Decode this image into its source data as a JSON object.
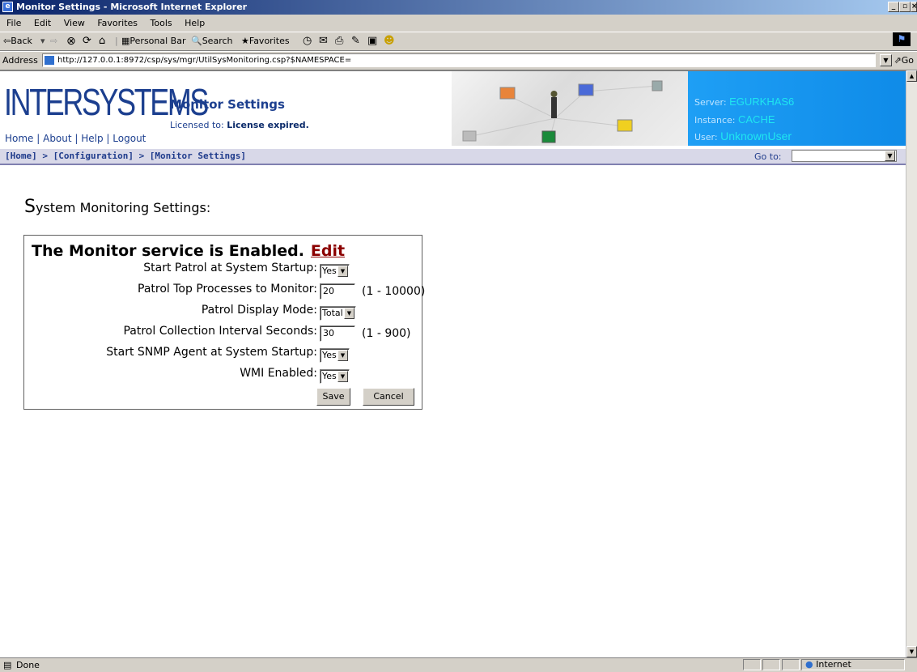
{
  "window": {
    "title": "Monitor Settings - Microsoft Internet Explorer",
    "menu": [
      "File",
      "Edit",
      "View",
      "Favorites",
      "Tools",
      "Help"
    ]
  },
  "toolbar": {
    "back": "⇦Back",
    "personal_bar": "Personal Bar",
    "search": "Search",
    "favorites": "Favorites"
  },
  "address": {
    "label": "Address",
    "url": "http://127.0.0.1:8972/csp/sys/mgr/UtilSysMonitoring.csp?$NAMESPACE=",
    "go": "Go"
  },
  "banner": {
    "logo": "InterSystems",
    "links": "Home | About | Help | Logout",
    "title": "Monitor Settings",
    "licensed_label": "Licensed to:",
    "license_value": "License expired.",
    "server_label": "Server:",
    "server_value": "EGURKHAS6",
    "instance_label": "Instance:",
    "instance_value": "CACHE",
    "user_label": "User:",
    "user_value": "UnknownUser"
  },
  "breadcrumb": {
    "text": "[Home] > [Configuration] > [Monitor Settings]",
    "goto_label": "Go to:"
  },
  "page": {
    "heading_first": "S",
    "heading_rest": "ystem Monitoring Settings:"
  },
  "form": {
    "status": "The Monitor service is Enabled.",
    "edit_link": "Edit",
    "start_patrol_label": "Start Patrol at System Startup:",
    "start_patrol_value": "Yes",
    "top_processes_label": "Patrol Top Processes to Monitor:",
    "top_processes_value": "20",
    "top_processes_range": "(1 - 10000)",
    "display_mode_label": "Patrol Display Mode:",
    "display_mode_value": "Total",
    "interval_label": "Patrol Collection Interval Seconds:",
    "interval_value": "30",
    "interval_range": "(1 - 900)",
    "snmp_label": "Start SNMP Agent at System Startup:",
    "snmp_value": "Yes",
    "wmi_label": "WMI Enabled:",
    "wmi_value": "Yes",
    "save": "Save",
    "cancel": "Cancel"
  },
  "status": {
    "text": "Done",
    "zone": "Internet"
  }
}
